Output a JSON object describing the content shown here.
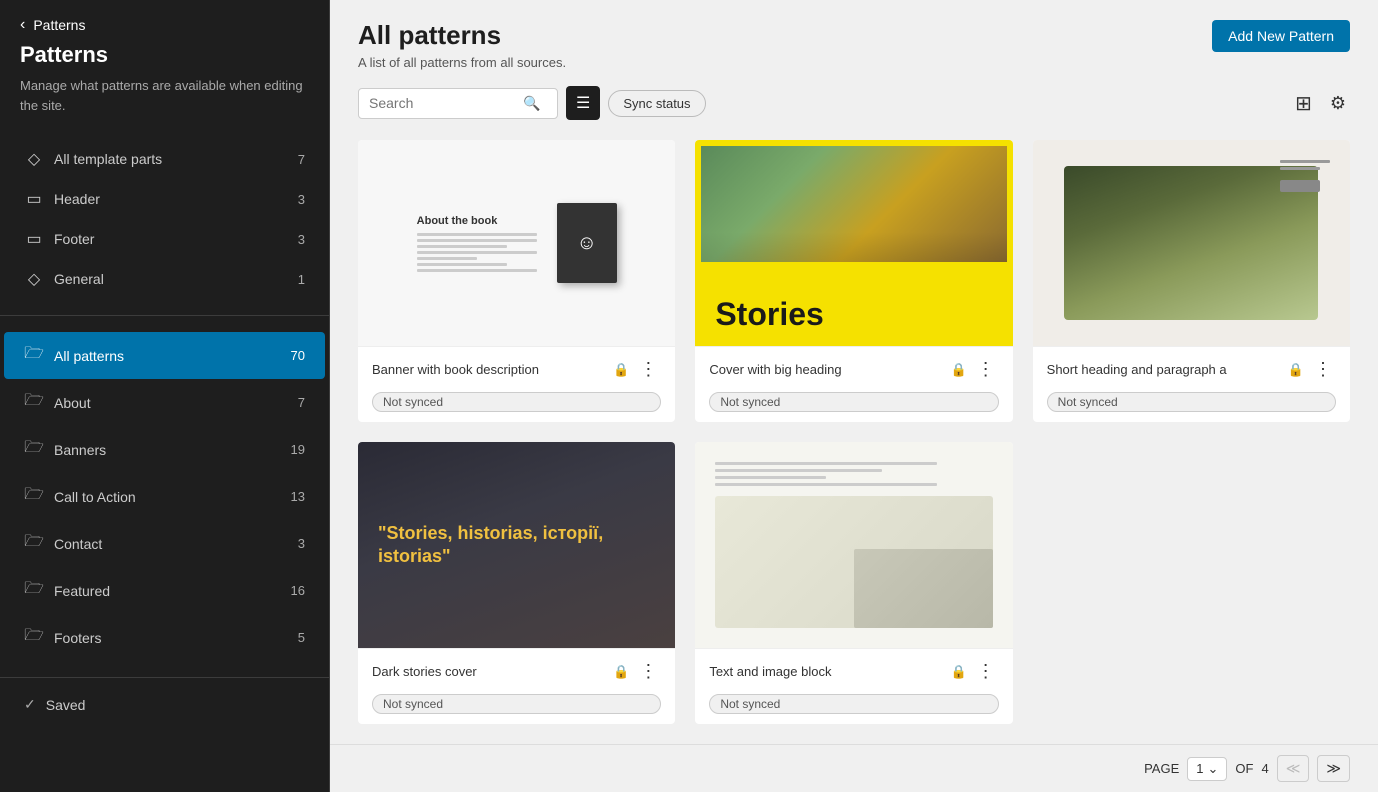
{
  "sidebar": {
    "back_label": "<",
    "title": "Patterns",
    "description": "Manage what patterns are available when editing the site.",
    "nav_items": [
      {
        "id": "all-template-parts",
        "icon": "◇",
        "label": "All template parts",
        "count": 7
      },
      {
        "id": "header",
        "icon": "▭",
        "label": "Header",
        "count": 3
      },
      {
        "id": "footer",
        "icon": "▭",
        "label": "Footer",
        "count": 3
      },
      {
        "id": "general",
        "icon": "◇",
        "label": "General",
        "count": 1
      }
    ],
    "all_patterns": {
      "icon": "📁",
      "label": "All patterns",
      "count": 70,
      "active": true
    },
    "pattern_categories": [
      {
        "id": "about",
        "label": "About",
        "count": 7
      },
      {
        "id": "banners",
        "label": "Banners",
        "count": 19
      },
      {
        "id": "call-to-action",
        "label": "Call to Action",
        "count": 13
      },
      {
        "id": "contact",
        "label": "Contact",
        "count": 3
      },
      {
        "id": "featured",
        "label": "Featured",
        "count": 16
      },
      {
        "id": "footers",
        "label": "Footers",
        "count": 5
      }
    ],
    "saved_label": "Saved"
  },
  "main": {
    "title": "All patterns",
    "subtitle": "A list of all patterns from all sources.",
    "add_pattern_btn": "Add New Pattern",
    "search_placeholder": "Search",
    "sync_status_label": "Sync status",
    "patterns": [
      {
        "id": "banner-book",
        "name": "Banner with book description",
        "sync_status": "Not synced",
        "type": "book"
      },
      {
        "id": "cover-big",
        "name": "Cover with big heading",
        "sync_status": "Not synced",
        "type": "stories-yellow"
      },
      {
        "id": "short-heading",
        "name": "Short heading and paragraph a",
        "sync_status": "Not synced",
        "type": "plant"
      },
      {
        "id": "dark-stories",
        "name": "Dark stories cover",
        "sync_status": "Not synced",
        "type": "dark-stories"
      },
      {
        "id": "last-pattern",
        "name": "Text and image block",
        "sync_status": "Not synced",
        "type": "last"
      }
    ],
    "pagination": {
      "page_label": "PAGE",
      "current_page": 1,
      "total_pages": 4,
      "of_label": "OF"
    }
  }
}
